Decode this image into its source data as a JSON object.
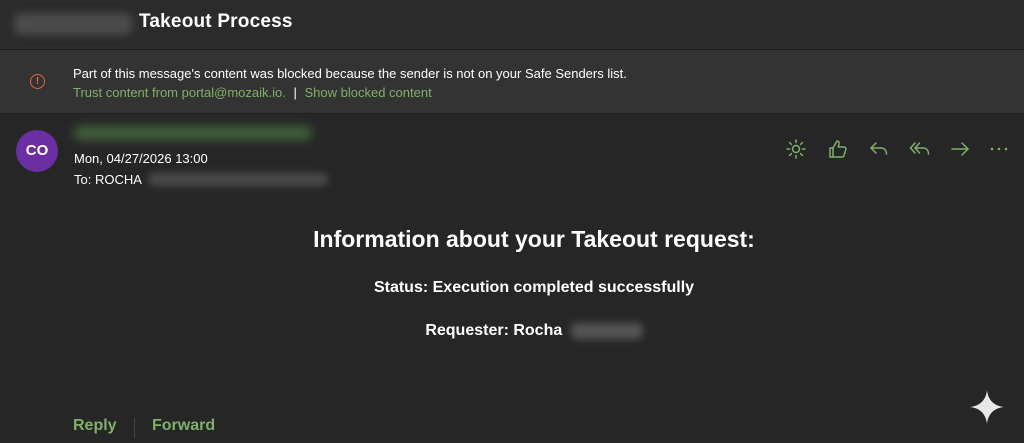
{
  "header": {
    "subject": "Takeout Process"
  },
  "banner": {
    "message": "Part of this message's content was blocked because the sender is not on your Safe Senders list.",
    "trust_link": "Trust content from portal@mozaik.io.",
    "separator": "|",
    "show_link": "Show blocked content",
    "warn_glyph": "!",
    "warn_color": "#e06a3c"
  },
  "message": {
    "avatar_initials": "CO",
    "avatar_color": "#6b2fa3",
    "date": "Mon, 04/27/2026 13:00",
    "to_prefix": "To: ROCHA"
  },
  "toolbar": {
    "icons": [
      "sun-icon",
      "thumbs-up-icon",
      "reply-icon",
      "reply-all-icon",
      "forward-icon",
      "more-icon"
    ],
    "accent_color": "#7fb069"
  },
  "body": {
    "title": "Information about your Takeout request:",
    "status": "Status: Execution completed successfully",
    "requester_label": "Requester: Rocha"
  },
  "footer": {
    "reply": "Reply",
    "forward": "Forward"
  }
}
